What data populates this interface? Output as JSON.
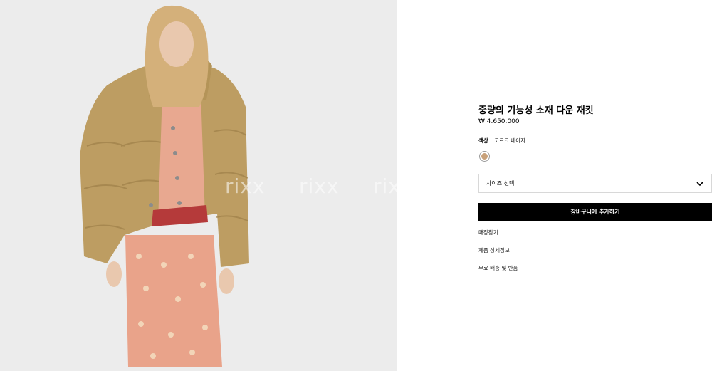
{
  "product": {
    "title": "중량의 기능성 소재 다운 재킷",
    "price": "₩ 4.650.000",
    "color_key": "색상",
    "color_value": "코르크 베이지",
    "swatch_color": "#c8a17a",
    "size_select": {
      "placeholder": "사이즈 선택"
    },
    "add_to_cart": "장바구니에 추가하기"
  },
  "links": {
    "store_finder": "매장찾기",
    "product_details": "제품 상세정보",
    "shipping_returns": "무료 배송 및 반품"
  },
  "gallery": {
    "watermarks": [
      "rixx",
      "rixx",
      "rixx"
    ],
    "image_desc_icon": "model-photo"
  }
}
